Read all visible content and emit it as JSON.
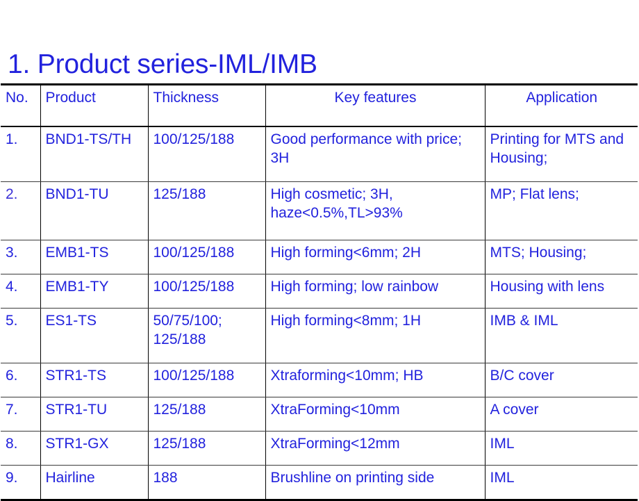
{
  "slide": {
    "title": "1. Product series-IML/IMB",
    "title_color": "#2222dd",
    "background_color": "#ffffff"
  },
  "table": {
    "columns": [
      {
        "key": "no",
        "label": "No.",
        "align": "left"
      },
      {
        "key": "product",
        "label": "Product",
        "align": "left"
      },
      {
        "key": "thickness",
        "label": "Thickness",
        "align": "left"
      },
      {
        "key": "key",
        "label": "Key features",
        "align": "center"
      },
      {
        "key": "app",
        "label": "Application",
        "align": "center"
      }
    ],
    "rows": [
      {
        "no": "1.",
        "product": "BND1-TS/TH",
        "thickness": "100/125/188",
        "key": "Good performance with price; 3H",
        "app": "Printing for MTS and Housing;"
      },
      {
        "no": "2.",
        "product": "BND1-TU",
        "thickness": "125/188",
        "key": "High cosmetic; 3H, haze<0.5%,TL>93%",
        "app": "MP; Flat lens;"
      },
      {
        "no": "3.",
        "product": "EMB1-TS",
        "thickness": "100/125/188",
        "key": "High forming<6mm; 2H",
        "app": "MTS; Housing;"
      },
      {
        "no": "4.",
        "product": "EMB1-TY",
        "thickness": "100/125/188",
        "key": "High forming; low rainbow",
        "app": "Housing with lens"
      },
      {
        "no": "5.",
        "product": "ES1-TS",
        "thickness": "50/75/100; 125/188",
        "key": "High forming<8mm; 1H",
        "app": "IMB & IML"
      },
      {
        "no": "6.",
        "product": "STR1-TS",
        "thickness": "100/125/188",
        "key": "Xtraforming<10mm; HB",
        "app": "B/C cover"
      },
      {
        "no": "7.",
        "product": "STR1-TU",
        "thickness": "125/188",
        "key": "XtraForming<10mm",
        "app": "A cover"
      },
      {
        "no": "8.",
        "product": "STR1-GX",
        "thickness": "125/188",
        "key": "XtraForming<12mm",
        "app": "IML"
      },
      {
        "no": "9.",
        "product": "Hairline",
        "thickness": "188",
        "key": "Brushline on printing side",
        "app": "IML"
      }
    ]
  },
  "colors": {
    "text_blue": "#2222dd",
    "number_blue": "#2b6fc4",
    "border_black": "#000000"
  }
}
